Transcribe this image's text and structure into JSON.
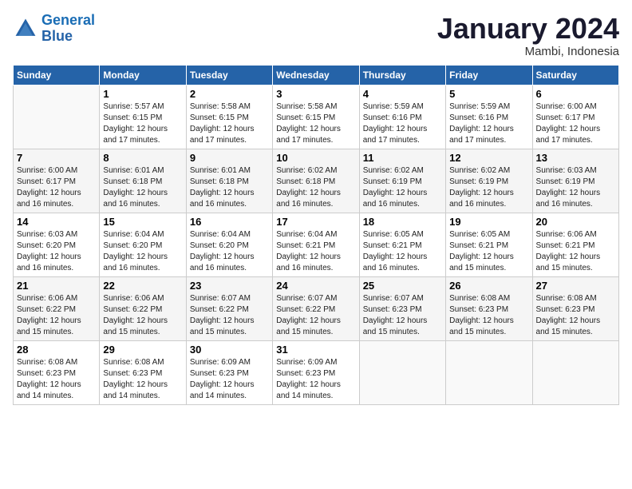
{
  "header": {
    "logo_line1": "General",
    "logo_line2": "Blue",
    "month": "January 2024",
    "location": "Mambi, Indonesia"
  },
  "weekdays": [
    "Sunday",
    "Monday",
    "Tuesday",
    "Wednesday",
    "Thursday",
    "Friday",
    "Saturday"
  ],
  "weeks": [
    [
      {
        "day": "",
        "info": ""
      },
      {
        "day": "1",
        "info": "Sunrise: 5:57 AM\nSunset: 6:15 PM\nDaylight: 12 hours\nand 17 minutes."
      },
      {
        "day": "2",
        "info": "Sunrise: 5:58 AM\nSunset: 6:15 PM\nDaylight: 12 hours\nand 17 minutes."
      },
      {
        "day": "3",
        "info": "Sunrise: 5:58 AM\nSunset: 6:15 PM\nDaylight: 12 hours\nand 17 minutes."
      },
      {
        "day": "4",
        "info": "Sunrise: 5:59 AM\nSunset: 6:16 PM\nDaylight: 12 hours\nand 17 minutes."
      },
      {
        "day": "5",
        "info": "Sunrise: 5:59 AM\nSunset: 6:16 PM\nDaylight: 12 hours\nand 17 minutes."
      },
      {
        "day": "6",
        "info": "Sunrise: 6:00 AM\nSunset: 6:17 PM\nDaylight: 12 hours\nand 17 minutes."
      }
    ],
    [
      {
        "day": "7",
        "info": "Sunrise: 6:00 AM\nSunset: 6:17 PM\nDaylight: 12 hours\nand 16 minutes."
      },
      {
        "day": "8",
        "info": "Sunrise: 6:01 AM\nSunset: 6:18 PM\nDaylight: 12 hours\nand 16 minutes."
      },
      {
        "day": "9",
        "info": "Sunrise: 6:01 AM\nSunset: 6:18 PM\nDaylight: 12 hours\nand 16 minutes."
      },
      {
        "day": "10",
        "info": "Sunrise: 6:02 AM\nSunset: 6:18 PM\nDaylight: 12 hours\nand 16 minutes."
      },
      {
        "day": "11",
        "info": "Sunrise: 6:02 AM\nSunset: 6:19 PM\nDaylight: 12 hours\nand 16 minutes."
      },
      {
        "day": "12",
        "info": "Sunrise: 6:02 AM\nSunset: 6:19 PM\nDaylight: 12 hours\nand 16 minutes."
      },
      {
        "day": "13",
        "info": "Sunrise: 6:03 AM\nSunset: 6:19 PM\nDaylight: 12 hours\nand 16 minutes."
      }
    ],
    [
      {
        "day": "14",
        "info": "Sunrise: 6:03 AM\nSunset: 6:20 PM\nDaylight: 12 hours\nand 16 minutes."
      },
      {
        "day": "15",
        "info": "Sunrise: 6:04 AM\nSunset: 6:20 PM\nDaylight: 12 hours\nand 16 minutes."
      },
      {
        "day": "16",
        "info": "Sunrise: 6:04 AM\nSunset: 6:20 PM\nDaylight: 12 hours\nand 16 minutes."
      },
      {
        "day": "17",
        "info": "Sunrise: 6:04 AM\nSunset: 6:21 PM\nDaylight: 12 hours\nand 16 minutes."
      },
      {
        "day": "18",
        "info": "Sunrise: 6:05 AM\nSunset: 6:21 PM\nDaylight: 12 hours\nand 16 minutes."
      },
      {
        "day": "19",
        "info": "Sunrise: 6:05 AM\nSunset: 6:21 PM\nDaylight: 12 hours\nand 15 minutes."
      },
      {
        "day": "20",
        "info": "Sunrise: 6:06 AM\nSunset: 6:21 PM\nDaylight: 12 hours\nand 15 minutes."
      }
    ],
    [
      {
        "day": "21",
        "info": "Sunrise: 6:06 AM\nSunset: 6:22 PM\nDaylight: 12 hours\nand 15 minutes."
      },
      {
        "day": "22",
        "info": "Sunrise: 6:06 AM\nSunset: 6:22 PM\nDaylight: 12 hours\nand 15 minutes."
      },
      {
        "day": "23",
        "info": "Sunrise: 6:07 AM\nSunset: 6:22 PM\nDaylight: 12 hours\nand 15 minutes."
      },
      {
        "day": "24",
        "info": "Sunrise: 6:07 AM\nSunset: 6:22 PM\nDaylight: 12 hours\nand 15 minutes."
      },
      {
        "day": "25",
        "info": "Sunrise: 6:07 AM\nSunset: 6:23 PM\nDaylight: 12 hours\nand 15 minutes."
      },
      {
        "day": "26",
        "info": "Sunrise: 6:08 AM\nSunset: 6:23 PM\nDaylight: 12 hours\nand 15 minutes."
      },
      {
        "day": "27",
        "info": "Sunrise: 6:08 AM\nSunset: 6:23 PM\nDaylight: 12 hours\nand 15 minutes."
      }
    ],
    [
      {
        "day": "28",
        "info": "Sunrise: 6:08 AM\nSunset: 6:23 PM\nDaylight: 12 hours\nand 14 minutes."
      },
      {
        "day": "29",
        "info": "Sunrise: 6:08 AM\nSunset: 6:23 PM\nDaylight: 12 hours\nand 14 minutes."
      },
      {
        "day": "30",
        "info": "Sunrise: 6:09 AM\nSunset: 6:23 PM\nDaylight: 12 hours\nand 14 minutes."
      },
      {
        "day": "31",
        "info": "Sunrise: 6:09 AM\nSunset: 6:23 PM\nDaylight: 12 hours\nand 14 minutes."
      },
      {
        "day": "",
        "info": ""
      },
      {
        "day": "",
        "info": ""
      },
      {
        "day": "",
        "info": ""
      }
    ]
  ]
}
